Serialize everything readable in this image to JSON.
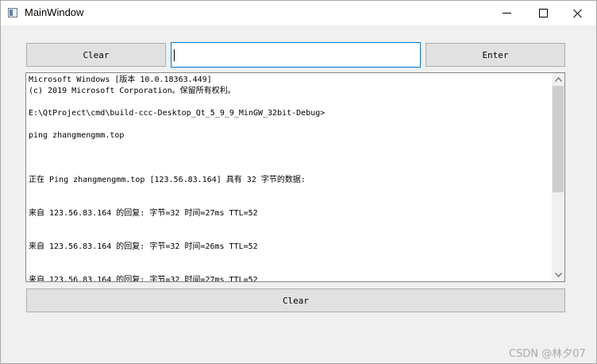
{
  "window": {
    "title": "MainWindow",
    "icon": "app-window-icon"
  },
  "toolbar": {
    "clear_label": "Clear",
    "enter_label": "Enter",
    "input_value": ""
  },
  "output": {
    "lines": [
      "Microsoft Windows [版本 10.0.18363.449]",
      "(c) 2019 Microsoft Corporation。保留所有权利。",
      "",
      "E:\\QtProject\\cmd\\build-ccc-Desktop_Qt_5_9_9_MinGW_32bit-Debug>",
      "",
      "ping zhangmengmm.top",
      "",
      "",
      "",
      "正在 Ping zhangmengmm.top [123.56.83.164] 具有 32 字节的数据:",
      "",
      "",
      "来自 123.56.83.164 的回复: 字节=32 时间=27ms TTL=52",
      "",
      "",
      "来自 123.56.83.164 的回复: 字节=32 时间=26ms TTL=52",
      "",
      "",
      "来自 123.56.83.164 的回复: 字节=32 时间=27ms TTL=52"
    ]
  },
  "bottom": {
    "clear_label": "Clear"
  },
  "watermark": "CSDN @林夕07"
}
